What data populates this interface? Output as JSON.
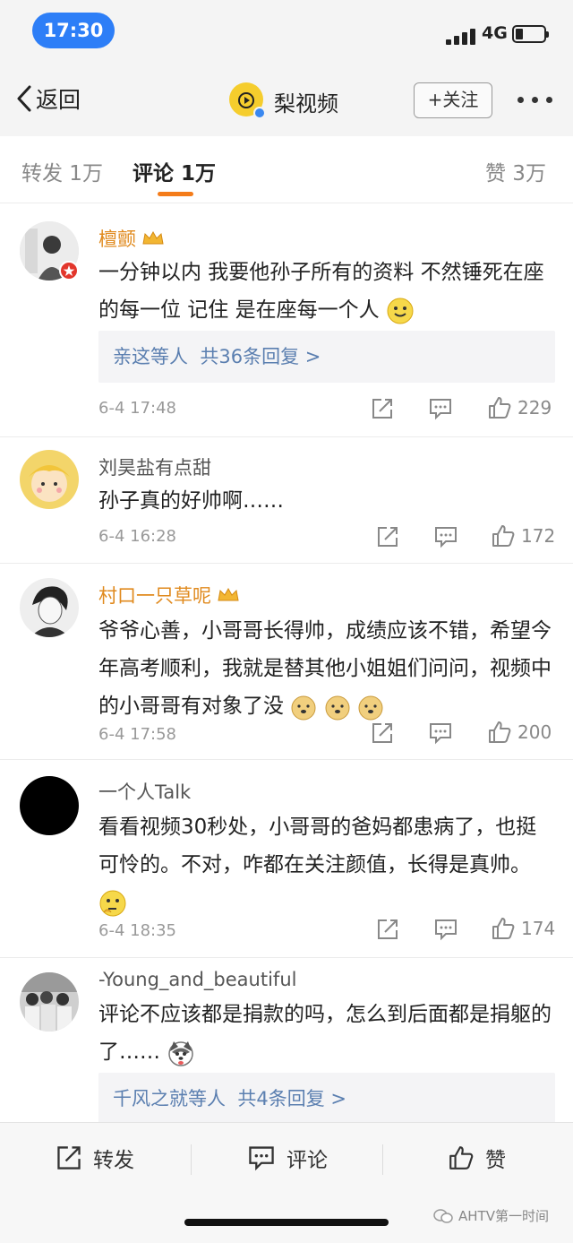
{
  "status_bar": {
    "time": "17:30",
    "network": "4G"
  },
  "navbar": {
    "back_label": "返回",
    "title": "梨视频",
    "follow_label": "+关注"
  },
  "tabs": [
    {
      "label": "转发 1万"
    },
    {
      "label": "评论 1万"
    },
    {
      "label": "赞 3万"
    }
  ],
  "comments": [
    {
      "name": "檀颤",
      "text": "一分钟以内 我要他孙子所有的资料 不然锤死在座的每一位 记住 是在座每一个人",
      "reply_prefix": "亲这等人",
      "reply_count": "共36条回复 >",
      "time": "6-4 17:48",
      "likes": "229"
    },
    {
      "name": "刘昊盐有点甜",
      "text": "孙子真的好帅啊……",
      "time": "6-4 16:28",
      "likes": "172"
    },
    {
      "name": "村口一只草呢",
      "text": "爷爷心善，小哥哥长得帅，成绩应该不错，希望今年高考顺利，我就是替其他小姐姐们问问，视频中的小哥哥有对象了没",
      "time": "6-4 17:58",
      "likes": "200"
    },
    {
      "name": "一个人Talk",
      "text": "看看视频30秒处，小哥哥的爸妈都患病了，也挺可怜的。不对，咋都在关注颜值，长得是真帅。",
      "time": "6-4 18:35",
      "likes": "174"
    },
    {
      "name": "-Young_and_beautiful",
      "text": "评论不应该都是捐款的吗，怎么到后面都是捐躯的了……",
      "reply_prefix": "千风之就等人",
      "reply_count": "共4条回复 >"
    }
  ],
  "bottom_bar": {
    "repost": "转发",
    "comment": "评论",
    "like": "赞"
  },
  "watermark": "AHTV第一时间",
  "colors": {
    "accent": "#f47c1a",
    "link": "#5b7fb0",
    "vip_name": "#e08a1e",
    "time_pill": "#2d7ef7"
  }
}
